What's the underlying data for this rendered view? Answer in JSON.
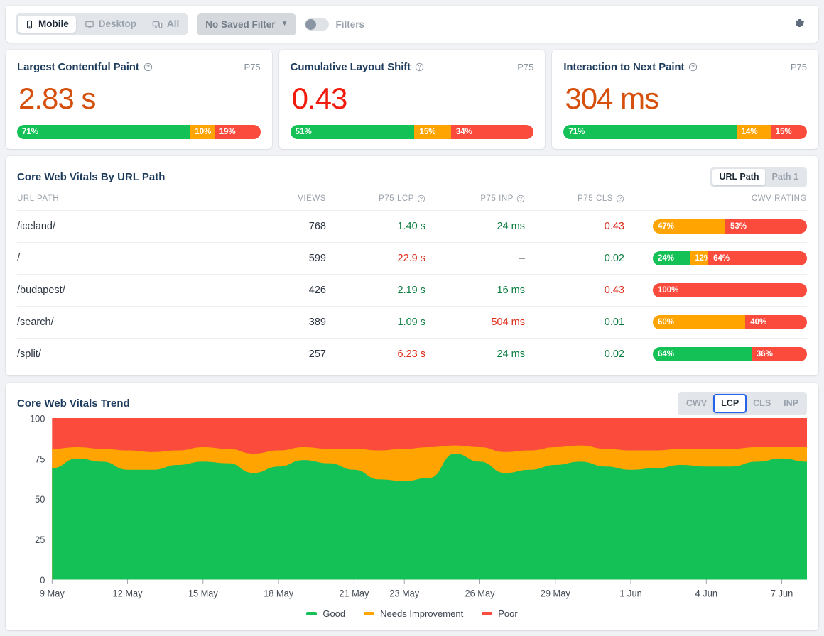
{
  "toolbar": {
    "devices": [
      {
        "label": "Mobile",
        "icon": "mobile-icon",
        "active": true
      },
      {
        "label": "Desktop",
        "icon": "desktop-icon",
        "active": false
      },
      {
        "label": "All",
        "icon": "all-devices-icon",
        "active": false
      }
    ],
    "saved_filter": "No Saved Filter",
    "filters_label": "Filters",
    "filters_enabled": false,
    "settings_icon": "gear-icon"
  },
  "metrics": [
    {
      "title": "Largest Contentful Paint",
      "info_icon": "help-circle-icon",
      "percentile": "P75",
      "value": "2.83 s",
      "value_color": "#d4500c",
      "distribution": [
        {
          "label": "71%",
          "pct": 71,
          "rating": "good"
        },
        {
          "label": "10%",
          "pct": 10,
          "rating": "needs-improvement"
        },
        {
          "label": "19%",
          "pct": 19,
          "rating": "poor"
        }
      ]
    },
    {
      "title": "Cumulative Layout Shift",
      "info_icon": "help-circle-icon",
      "percentile": "P75",
      "value": "0.43",
      "value_color": "#f01b0d",
      "distribution": [
        {
          "label": "51%",
          "pct": 51,
          "rating": "good"
        },
        {
          "label": "15%",
          "pct": 15,
          "rating": "needs-improvement"
        },
        {
          "label": "34%",
          "pct": 34,
          "rating": "poor"
        }
      ]
    },
    {
      "title": "Interaction to Next Paint",
      "info_icon": "help-circle-icon",
      "percentile": "P75",
      "value": "304 ms",
      "value_color": "#d4500c",
      "distribution": [
        {
          "label": "71%",
          "pct": 71,
          "rating": "good"
        },
        {
          "label": "14%",
          "pct": 14,
          "rating": "needs-improvement"
        },
        {
          "label": "15%",
          "pct": 15,
          "rating": "poor"
        }
      ]
    }
  ],
  "table_panel": {
    "title": "Core Web Vitals By URL Path",
    "grouping_tabs": [
      {
        "label": "URL Path",
        "active": true
      },
      {
        "label": "Path 1",
        "active": false
      }
    ],
    "columns": [
      {
        "key": "path",
        "label": "URL PATH",
        "align": "left"
      },
      {
        "key": "views",
        "label": "VIEWS",
        "align": "right"
      },
      {
        "key": "lcp",
        "label": "P75 LCP",
        "align": "right",
        "info_icon": "help-circle-icon"
      },
      {
        "key": "inp",
        "label": "P75 INP",
        "align": "right",
        "info_icon": "help-circle-icon"
      },
      {
        "key": "cls",
        "label": "P75 CLS",
        "align": "right",
        "info_icon": "help-circle-icon"
      },
      {
        "key": "rating",
        "label": "CWV RATING",
        "align": "right"
      }
    ],
    "rows": [
      {
        "path": "/iceland/",
        "views": "768",
        "lcp": "1.40 s",
        "lcp_rating": "good",
        "inp": "24 ms",
        "inp_rating": "good",
        "cls": "0.43",
        "cls_rating": "poor",
        "rating": [
          {
            "label": "47%",
            "pct": 47,
            "rating": "needs-improvement"
          },
          {
            "label": "53%",
            "pct": 53,
            "rating": "poor"
          }
        ]
      },
      {
        "path": "/",
        "views": "599",
        "lcp": "22.9 s",
        "lcp_rating": "poor",
        "inp": "–",
        "inp_rating": "none",
        "cls": "0.02",
        "cls_rating": "good",
        "rating": [
          {
            "label": "24%",
            "pct": 24,
            "rating": "good"
          },
          {
            "label": "12%",
            "pct": 12,
            "rating": "needs-improvement"
          },
          {
            "label": "64%",
            "pct": 64,
            "rating": "poor"
          }
        ]
      },
      {
        "path": "/budapest/",
        "views": "426",
        "lcp": "2.19 s",
        "lcp_rating": "good",
        "inp": "16 ms",
        "inp_rating": "good",
        "cls": "0.43",
        "cls_rating": "poor",
        "rating": [
          {
            "label": "100%",
            "pct": 100,
            "rating": "poor"
          }
        ]
      },
      {
        "path": "/search/",
        "views": "389",
        "lcp": "1.09 s",
        "lcp_rating": "good",
        "inp": "504 ms",
        "inp_rating": "poor",
        "cls": "0.01",
        "cls_rating": "good",
        "rating": [
          {
            "label": "60%",
            "pct": 60,
            "rating": "needs-improvement"
          },
          {
            "label": "40%",
            "pct": 40,
            "rating": "poor"
          }
        ]
      },
      {
        "path": "/split/",
        "views": "257",
        "lcp": "6.23 s",
        "lcp_rating": "poor",
        "inp": "24 ms",
        "inp_rating": "good",
        "cls": "0.02",
        "cls_rating": "good",
        "rating": [
          {
            "label": "64%",
            "pct": 64,
            "rating": "good"
          },
          {
            "label": "36%",
            "pct": 36,
            "rating": "poor"
          }
        ]
      }
    ]
  },
  "trend_panel": {
    "title": "Core Web Vitals Trend",
    "metric_tabs": [
      {
        "label": "CWV",
        "active": false
      },
      {
        "label": "LCP",
        "active": true
      },
      {
        "label": "CLS",
        "active": false
      },
      {
        "label": "INP",
        "active": false
      }
    ]
  },
  "colors": {
    "good": "#13c156",
    "needs_improvement": "#ffa400",
    "poor": "#fa4b3c",
    "heading": "#1d3b5c",
    "muted": "#9aa3ad"
  },
  "chart_data": {
    "type": "area",
    "title": "Core Web Vitals Trend",
    "stacked": true,
    "percent": true,
    "xlabel": "",
    "ylabel": "",
    "ylim": [
      0,
      100
    ],
    "yticks": [
      0,
      25,
      50,
      75,
      100
    ],
    "grid": false,
    "legend_position": "bottom",
    "x_tick_labels": [
      "9 May",
      "12 May",
      "15 May",
      "18 May",
      "21 May",
      "23 May",
      "26 May",
      "29 May",
      "1 Jun",
      "4 Jun",
      "7 Jun"
    ],
    "x": [
      "9 May",
      "10 May",
      "11 May",
      "12 May",
      "13 May",
      "14 May",
      "15 May",
      "16 May",
      "17 May",
      "18 May",
      "19 May",
      "20 May",
      "21 May",
      "22 May",
      "23 May",
      "24 May",
      "25 May",
      "26 May",
      "27 May",
      "28 May",
      "29 May",
      "30 May",
      "31 May",
      "1 Jun",
      "2 Jun",
      "3 Jun",
      "4 Jun",
      "5 Jun",
      "6 Jun",
      "7 Jun",
      "8 Jun"
    ],
    "series": [
      {
        "name": "Good",
        "color": "#13c156",
        "values": [
          69,
          75,
          73,
          68,
          68,
          71,
          73,
          72,
          66,
          70,
          74,
          72,
          68,
          62,
          61,
          63,
          78,
          73,
          66,
          68,
          71,
          73,
          70,
          68,
          69,
          71,
          70,
          70,
          73,
          75,
          73
        ]
      },
      {
        "name": "Needs Improvement",
        "color": "#ffa400",
        "values": [
          12,
          7,
          8,
          12,
          11,
          9,
          9,
          9,
          12,
          10,
          8,
          9,
          13,
          18,
          20,
          19,
          5,
          9,
          13,
          12,
          11,
          10,
          11,
          12,
          11,
          10,
          11,
          11,
          9,
          7,
          9
        ]
      },
      {
        "name": "Poor",
        "color": "#fa4b3c",
        "values": [
          19,
          18,
          19,
          20,
          21,
          20,
          18,
          19,
          22,
          20,
          18,
          19,
          19,
          20,
          19,
          18,
          17,
          18,
          21,
          20,
          18,
          17,
          19,
          20,
          20,
          19,
          19,
          19,
          18,
          18,
          18
        ]
      }
    ]
  }
}
